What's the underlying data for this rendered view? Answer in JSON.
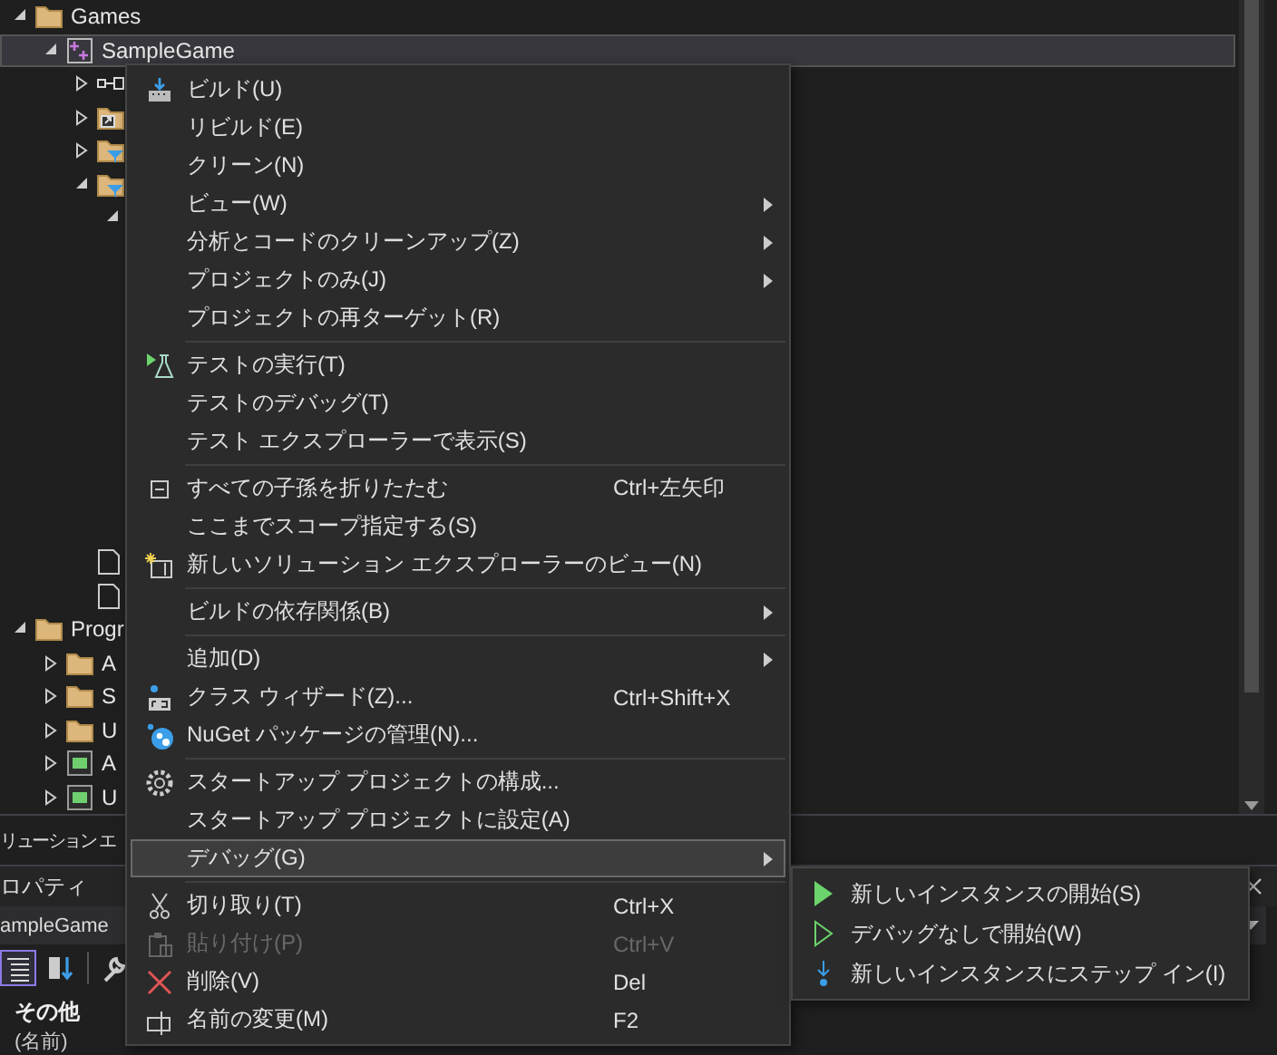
{
  "tree": [
    {
      "label": "Games",
      "kind": "folder",
      "expanded": true,
      "selected": false,
      "children": [
        {
          "label": "SampleGame",
          "kind": "project",
          "expanded": true,
          "selected": true,
          "children": [
            {
              "kind": "references",
              "expanded": false,
              "selected": false
            },
            {
              "kind": "properties",
              "expanded": false,
              "selected": false
            },
            {
              "kind": "filter-folder",
              "expanded": false,
              "selected": false
            },
            {
              "kind": "filter-folder",
              "expanded": true,
              "selected": false,
              "children": [
                {
                  "kind": "covered",
                  "expanded": true,
                  "selected": false
                }
              ]
            },
            {
              "kind": "file",
              "selected": false
            },
            {
              "kind": "file",
              "selected": false
            }
          ]
        }
      ]
    },
    {
      "label": "Progr",
      "kind": "folder",
      "expanded": true,
      "selected": false,
      "children": [
        {
          "label": "A",
          "kind": "folder",
          "expanded": false,
          "selected": false
        },
        {
          "label": "S",
          "kind": "folder",
          "expanded": false,
          "selected": false
        },
        {
          "label": "U",
          "kind": "folder",
          "expanded": false,
          "selected": false
        },
        {
          "label": "A",
          "kind": "csharp",
          "expanded": false,
          "selected": false
        },
        {
          "label": "U",
          "kind": "csharp",
          "expanded": false,
          "selected": false
        }
      ]
    }
  ],
  "bottom_tab": {
    "label": "リューション エ"
  },
  "properties": {
    "title": "ロパティ",
    "object": "ampleGame",
    "toolbar": [
      {
        "selected": true
      },
      {
        "selected": false
      },
      {
        "selected": false
      }
    ],
    "category": "その他",
    "row": "(名前)"
  },
  "menu": {
    "items": [
      {
        "kind": "item",
        "label": "ビルド(U)",
        "submenu": false,
        "disabled": false,
        "selected": false
      },
      {
        "kind": "item",
        "label": "リビルド(E)",
        "submenu": false,
        "disabled": false,
        "selected": false
      },
      {
        "kind": "item",
        "label": "クリーン(N)",
        "submenu": false,
        "disabled": false,
        "selected": false
      },
      {
        "kind": "item",
        "label": "ビュー(W)",
        "submenu": true,
        "disabled": false,
        "selected": false
      },
      {
        "kind": "item",
        "label": "分析とコードのクリーンアップ(Z)",
        "submenu": true,
        "disabled": false,
        "selected": false
      },
      {
        "kind": "item",
        "label": "プロジェクトのみ(J)",
        "submenu": true,
        "disabled": false,
        "selected": false
      },
      {
        "kind": "item",
        "label": "プロジェクトの再ターゲット(R)",
        "submenu": false,
        "disabled": false,
        "selected": false
      },
      {
        "kind": "separator"
      },
      {
        "kind": "item",
        "label": "テストの実行(T)",
        "submenu": false,
        "disabled": false,
        "selected": false
      },
      {
        "kind": "item",
        "label": "テストのデバッグ(T)",
        "submenu": false,
        "disabled": false,
        "selected": false
      },
      {
        "kind": "item",
        "label": "テスト エクスプローラーで表示(S)",
        "submenu": false,
        "disabled": false,
        "selected": false
      },
      {
        "kind": "separator"
      },
      {
        "kind": "item",
        "label": "すべての子孫を折りたたむ",
        "shortcut": "Ctrl+左矢印",
        "submenu": false,
        "disabled": false,
        "selected": false
      },
      {
        "kind": "item",
        "label": "ここまでスコープ指定する(S)",
        "submenu": false,
        "disabled": false,
        "selected": false
      },
      {
        "kind": "item",
        "label": "新しいソリューション エクスプローラーのビュー(N)",
        "submenu": false,
        "disabled": false,
        "selected": false
      },
      {
        "kind": "separator"
      },
      {
        "kind": "item",
        "label": "ビルドの依存関係(B)",
        "submenu": true,
        "disabled": false,
        "selected": false
      },
      {
        "kind": "separator"
      },
      {
        "kind": "item",
        "label": "追加(D)",
        "submenu": true,
        "disabled": false,
        "selected": false
      },
      {
        "kind": "item",
        "label": "クラス ウィザード(Z)...",
        "shortcut": "Ctrl+Shift+X",
        "submenu": false,
        "disabled": false,
        "selected": false
      },
      {
        "kind": "item",
        "label": "NuGet パッケージの管理(N)...",
        "submenu": false,
        "disabled": false,
        "selected": false
      },
      {
        "kind": "separator"
      },
      {
        "kind": "item",
        "label": "スタートアップ プロジェクトの構成...",
        "submenu": false,
        "disabled": false,
        "selected": false
      },
      {
        "kind": "item",
        "label": "スタートアップ プロジェクトに設定(A)",
        "submenu": false,
        "disabled": false,
        "selected": false
      },
      {
        "kind": "item",
        "label": "デバッグ(G)",
        "submenu": true,
        "disabled": false,
        "selected": true
      },
      {
        "kind": "separator"
      },
      {
        "kind": "item",
        "label": "切り取り(T)",
        "shortcut": "Ctrl+X",
        "submenu": false,
        "disabled": false,
        "selected": false
      },
      {
        "kind": "item",
        "label": "貼り付け(P)",
        "shortcut": "Ctrl+V",
        "submenu": false,
        "disabled": true,
        "selected": false
      },
      {
        "kind": "item",
        "label": "削除(V)",
        "shortcut": "Del",
        "submenu": false,
        "disabled": false,
        "selected": false
      },
      {
        "kind": "item",
        "label": "名前の変更(M)",
        "shortcut": "F2",
        "submenu": false,
        "disabled": false,
        "selected": false
      }
    ]
  },
  "submenu": {
    "items": [
      {
        "label": "新しいインスタンスの開始(S)"
      },
      {
        "label": "デバッグなしで開始(W)"
      },
      {
        "label": "新しいインスタンスにステップ イン(I)"
      }
    ]
  }
}
